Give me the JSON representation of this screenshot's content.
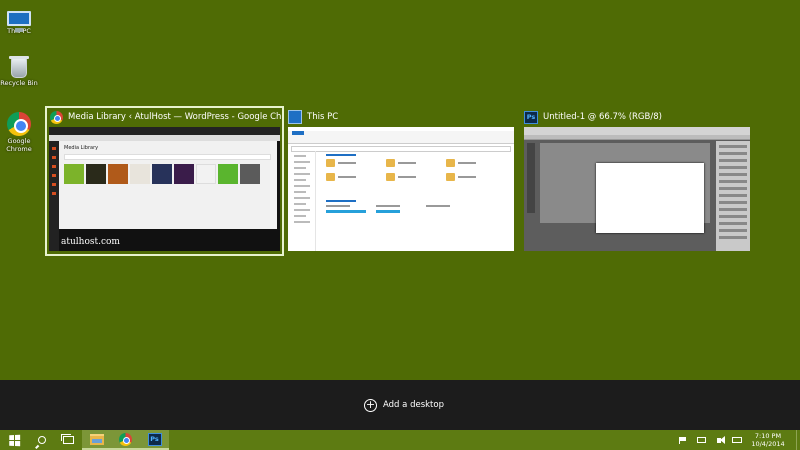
{
  "desktop": {
    "icons": [
      {
        "label": "This PC",
        "icon": "this-pc-icon"
      },
      {
        "label": "Recycle Bin",
        "icon": "recycle-bin-icon"
      },
      {
        "label": "Google Chrome",
        "icon": "chrome-icon"
      }
    ]
  },
  "task_view": {
    "windows": [
      {
        "title": "Media Library ‹ AtulHost — WordPress - Google Chrome",
        "icon": "chrome-icon",
        "active": true,
        "thumb": {
          "page_heading": "Media Library",
          "brand": "atulhost.com"
        }
      },
      {
        "title": "This PC",
        "icon": "file-explorer-icon",
        "active": false
      },
      {
        "title": "Untitled-1 @ 66.7% (RGB/8)",
        "icon": "photoshop-icon",
        "icon_text": "Ps",
        "active": false
      }
    ]
  },
  "add_desktop": {
    "label": "Add a desktop"
  },
  "taskbar": {
    "pinned": [
      {
        "icon": "start-windows-icon"
      },
      {
        "icon": "search-icon"
      },
      {
        "icon": "task-view-icon"
      },
      {
        "icon": "file-explorer-icon"
      },
      {
        "icon": "chrome-icon"
      },
      {
        "icon": "photoshop-icon",
        "text": "Ps"
      }
    ],
    "clock": {
      "time": "7:10 PM",
      "date": "10/4/2014"
    }
  },
  "colors": {
    "desktop_bg": "#4f6b05",
    "taskbar_bg": "#5d7b12",
    "add_bar_bg": "#1c1c1c",
    "active_outline": "#e8f3cf"
  }
}
